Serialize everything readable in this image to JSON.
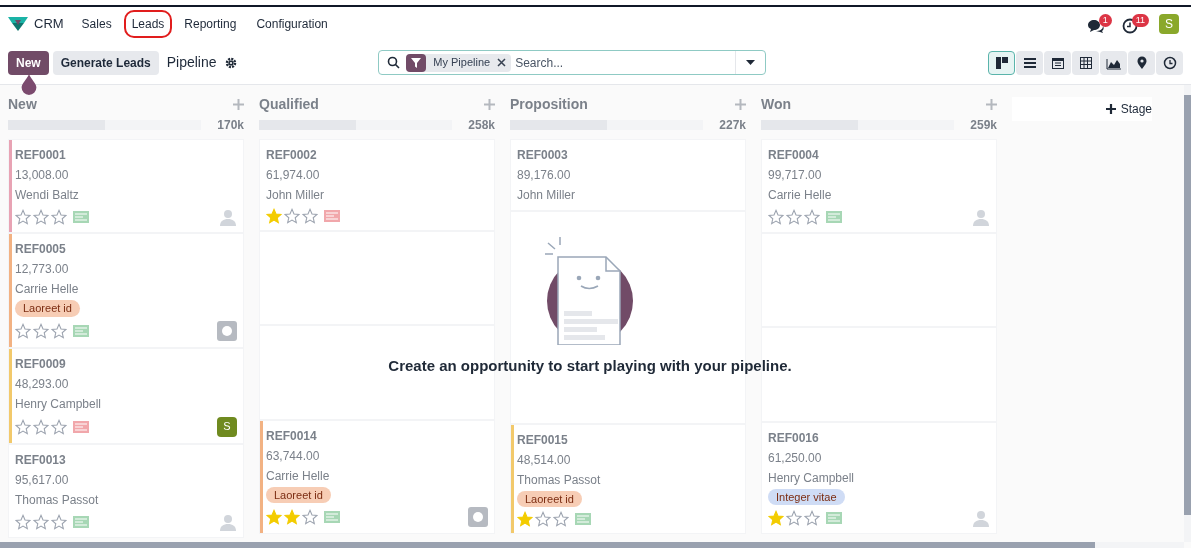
{
  "app": {
    "name": "CRM"
  },
  "menu": [
    {
      "label": "Sales",
      "highlighted": false
    },
    {
      "label": "Leads",
      "highlighted": true
    },
    {
      "label": "Reporting",
      "highlighted": false
    },
    {
      "label": "Configuration",
      "highlighted": false
    }
  ],
  "systray": {
    "messages_badge": "1",
    "activities_badge": "11",
    "user_initial": "S"
  },
  "control_panel": {
    "new_button": "New",
    "generate_button": "Generate Leads",
    "breadcrumb": "Pipeline",
    "search": {
      "facet": "My Pipeline",
      "placeholder": "Search..."
    },
    "views": [
      {
        "kind": "kanban",
        "selected": true
      },
      {
        "kind": "list",
        "selected": false
      },
      {
        "kind": "calendar",
        "selected": false
      },
      {
        "kind": "pivot",
        "selected": false
      },
      {
        "kind": "graph",
        "selected": false
      },
      {
        "kind": "map",
        "selected": false
      },
      {
        "kind": "activity",
        "selected": false
      }
    ]
  },
  "columns": [
    {
      "name": "New",
      "total": "170k",
      "level": 0.5,
      "cards": [
        {
          "kind": "card",
          "ref": "REF0001",
          "amount": "13,008.00",
          "contact": "Wendi Baltz",
          "stars": 0,
          "overdue": false,
          "avatar": {
            "kind": "person"
          },
          "color": "#e8a3b4"
        },
        {
          "kind": "card",
          "ref": "REF0005",
          "amount": "12,773.00",
          "contact": "Carrie Helle",
          "tags": [
            {
              "label": "Laoreet id",
              "color": "#f7cdb5"
            }
          ],
          "stars": 0,
          "overdue": false,
          "avatar": {
            "kind": "photo"
          },
          "color": "#f2b283"
        },
        {
          "kind": "card",
          "ref": "REF0009",
          "amount": "48,293.00",
          "contact": "Henry Campbell",
          "stars": 0,
          "overdue": true,
          "avatar": {
            "kind": "initial",
            "text": "S"
          },
          "color": "#f2c96b"
        },
        {
          "kind": "card",
          "ref": "REF0013",
          "amount": "95,617.00",
          "contact": "Thomas Passot",
          "stars": 0,
          "overdue": false,
          "avatar": {
            "kind": "person"
          }
        }
      ]
    },
    {
      "name": "Qualified",
      "total": "258k",
      "level": 0.5,
      "cards": [
        {
          "kind": "card",
          "ref": "REF0002",
          "amount": "61,974.00",
          "contact": "John Miller",
          "stars": 1,
          "overdue": true
        },
        {
          "kind": "covered"
        },
        {
          "kind": "covered"
        },
        {
          "kind": "card",
          "ref": "REF0014",
          "amount": "63,744.00",
          "contact": "Carrie Helle",
          "tags": [
            {
              "label": "Laoreet id",
              "color": "#f7cdb5"
            }
          ],
          "stars": 2,
          "overdue": false,
          "avatar": {
            "kind": "photo"
          },
          "color": "#f2b283"
        }
      ]
    },
    {
      "name": "Proposition",
      "total": "227k",
      "level": 0.5,
      "cards": [
        {
          "kind": "card",
          "ref": "REF0003",
          "amount": "89,176.00",
          "contact": "John Miller"
        },
        {
          "kind": "covered"
        },
        {
          "kind": "card",
          "ref": "REF0015",
          "amount": "48,514.00",
          "contact": "Thomas Passot",
          "tags": [
            {
              "label": "Laoreet id",
              "color": "#f7cdb5"
            }
          ],
          "stars": 1,
          "overdue": false,
          "color": "#f2c96b"
        }
      ]
    },
    {
      "name": "Won",
      "total": "259k",
      "level": 0.5,
      "cards": [
        {
          "kind": "card",
          "ref": "REF0004",
          "amount": "99,717.00",
          "contact": "Carrie Helle",
          "stars": 0,
          "overdue": false,
          "avatar": {
            "kind": "person"
          }
        },
        {
          "kind": "covered"
        },
        {
          "kind": "covered"
        },
        {
          "kind": "card",
          "ref": "REF0016",
          "amount": "61,250.00",
          "contact": "Henry Campbell",
          "tags": [
            {
              "label": "Integer vitae",
              "color": "#cfdcf5"
            }
          ],
          "stars": 1,
          "overdue": false,
          "avatar": {
            "kind": "person"
          }
        }
      ]
    }
  ],
  "add_stage": "Stage",
  "empty_state": {
    "message": "Create an opportunity to start playing with your pipeline."
  }
}
